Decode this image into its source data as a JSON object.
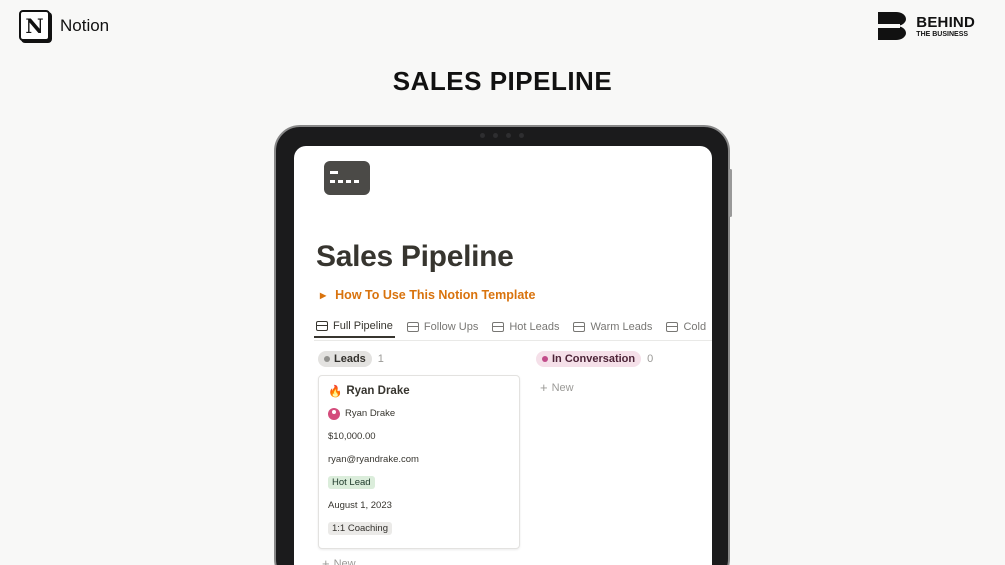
{
  "header": {
    "notion_logo_letter": "N",
    "notion_label": "Notion",
    "btb_line1": "BEHIND",
    "btb_line2": "THE BUSINESS",
    "main_title": "SALES PIPELINE"
  },
  "page": {
    "icon": "credit-card-icon",
    "title": "Sales Pipeline",
    "toggle_label": "How To Use This Notion Template",
    "accent_color": "#d9730d"
  },
  "tabs": [
    {
      "label": "Full Pipeline",
      "icon": "board-icon",
      "active": true
    },
    {
      "label": "Follow Ups",
      "icon": "calendar-icon",
      "active": false
    },
    {
      "label": "Hot Leads",
      "icon": "table-icon",
      "active": false
    },
    {
      "label": "Warm Leads",
      "icon": "table-icon",
      "active": false
    },
    {
      "label": "Cold",
      "icon": "table-icon",
      "active": false
    }
  ],
  "board": {
    "columns": [
      {
        "name": "Leads",
        "count": "1",
        "color": "#91918e"
      },
      {
        "name": "In Conversation",
        "count": "0",
        "color": "#c14c8a"
      }
    ],
    "new_label": "New",
    "card": {
      "emoji": "🔥",
      "title": "Ryan Drake",
      "owner": "Ryan Drake",
      "value": "$10,000.00",
      "email": "ryan@ryandrake.com",
      "status_tag": "Hot Lead",
      "date": "August 1, 2023",
      "product_tag": "1:1 Coaching"
    }
  }
}
